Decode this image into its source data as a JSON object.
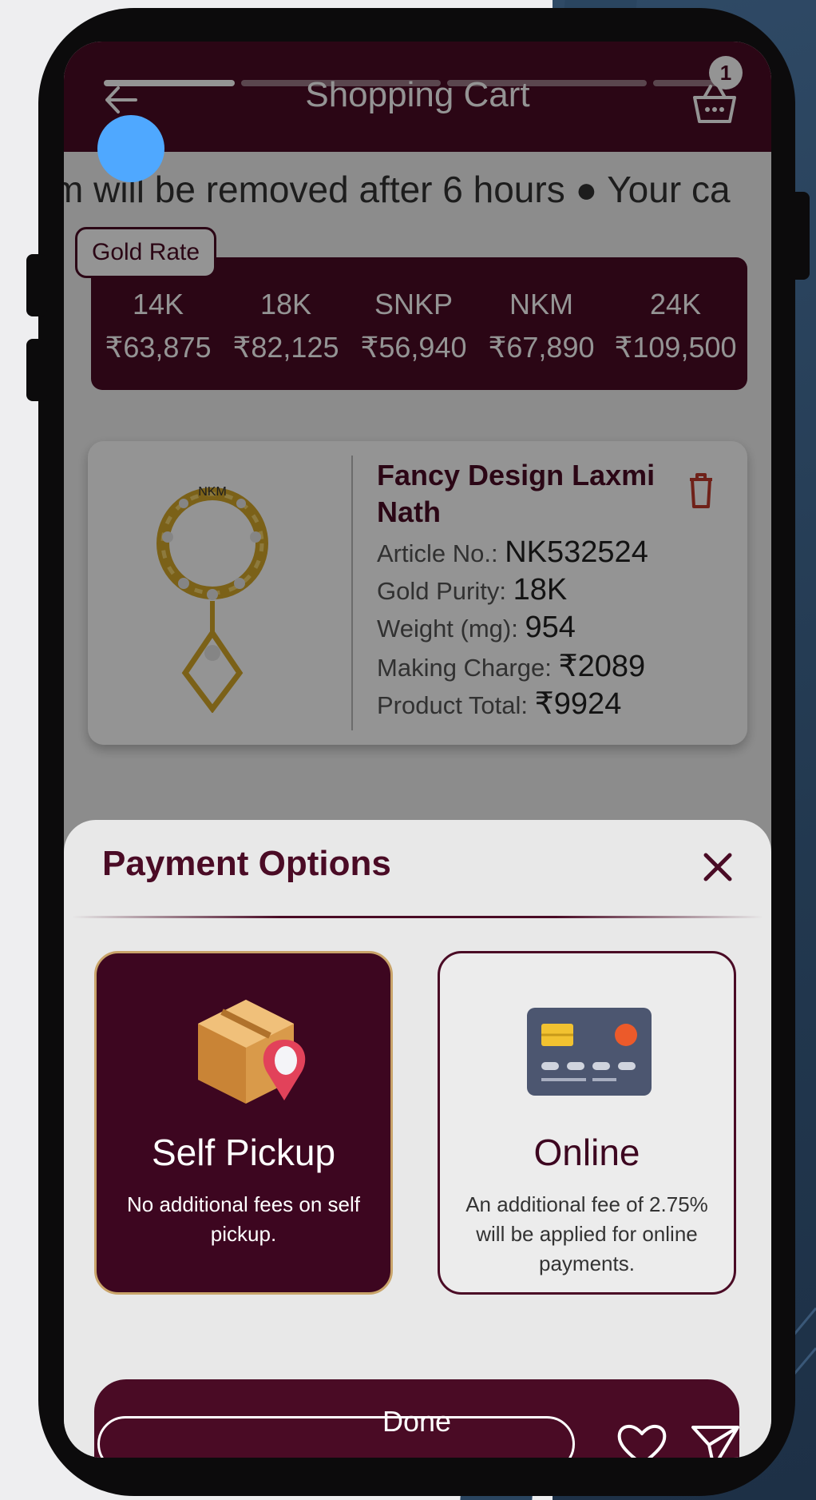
{
  "header": {
    "title": "Shopping Cart",
    "cart_count": "1"
  },
  "marquee": {
    "text": "m will be removed after 6 hours ● Your ca"
  },
  "gold_rate": {
    "label": "Gold Rate",
    "rates": [
      {
        "karat": "14K",
        "price": "₹63,875"
      },
      {
        "karat": "18K",
        "price": "₹82,125"
      },
      {
        "karat": "SNKP",
        "price": "₹56,940"
      },
      {
        "karat": "NKM",
        "price": "₹67,890"
      },
      {
        "karat": "24K",
        "price": "₹109,500"
      }
    ]
  },
  "product": {
    "name": "Fancy Design Laxmi Nath",
    "image_label": "NKM",
    "article_label": "Article No.:",
    "article_value": "NK532524",
    "purity_label": "Gold Purity:",
    "purity_value": "18K",
    "weight_label": "Weight (mg):",
    "weight_value": "954",
    "making_label": "Making Charge:",
    "making_value": "₹2089",
    "total_label": "Product Total:",
    "total_value": "₹9924"
  },
  "payment": {
    "title": "Payment Options",
    "options": [
      {
        "title": "Self Pickup",
        "desc": "No additional fees on self pickup.",
        "selected": true
      },
      {
        "title": "Online",
        "desc": "An additional fee of 2.75% will be applied for online payments.",
        "selected": false
      }
    ],
    "done_label": "Done"
  },
  "colors": {
    "brand": "#4a0b25",
    "accent_border": "#c9a46a",
    "delete": "#c0392b"
  }
}
